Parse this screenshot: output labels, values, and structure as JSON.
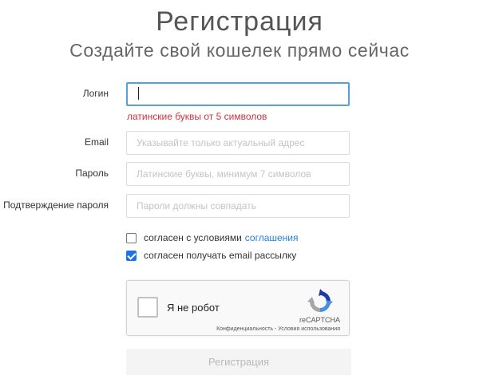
{
  "header": {
    "title": "Регистрация",
    "subtitle": "Создайте свой кошелек прямо сейчас"
  },
  "form": {
    "login": {
      "label": "Логин",
      "value": "",
      "hint": "латинские буквы от 5 символов"
    },
    "email": {
      "label": "Email",
      "placeholder": "Указывайте только актуальный адрес"
    },
    "password": {
      "label": "Пароль",
      "placeholder": "Латинские буквы, минимум 7 символов"
    },
    "confirm": {
      "label": "Подтверждение пароля",
      "placeholder": "Пароли должны совпадать"
    },
    "agree_terms": {
      "text": "согласен с условиями",
      "link": "соглашения",
      "checked": false
    },
    "agree_email": {
      "text": "согласен получать email рассылку",
      "checked": true
    },
    "captcha": {
      "label": "Я не робот",
      "brand": "reCAPTCHA",
      "terms": "Конфиденциальность - Условия использования",
      "icon": "recaptcha-logo-icon"
    },
    "submit_label": "Регистрация"
  },
  "colors": {
    "accent": "#1a73e8",
    "focus_border": "#5aa0d8",
    "error": "#d0323c",
    "link": "#2a7fd4"
  }
}
